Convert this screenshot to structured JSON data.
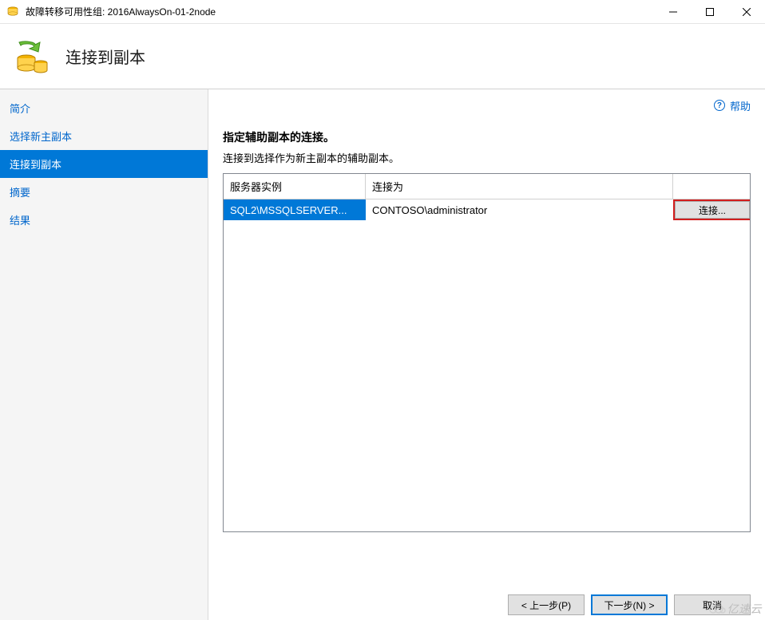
{
  "window": {
    "title": "故障转移可用性组: 2016AlwaysOn-01-2node"
  },
  "header": {
    "title": "连接到副本"
  },
  "help": {
    "label": "帮助"
  },
  "sidebar": {
    "steps": [
      {
        "label": "简介"
      },
      {
        "label": "选择新主副本"
      },
      {
        "label": "连接到副本"
      },
      {
        "label": "摘要"
      },
      {
        "label": "结果"
      }
    ],
    "active_index": 2
  },
  "content": {
    "section_title": "指定辅助副本的连接。",
    "section_sub": "连接到选择作为新主副本的辅助副本。",
    "grid": {
      "headers": {
        "server": "服务器实例",
        "connect_as": "连接为",
        "action": ""
      },
      "rows": [
        {
          "server": "SQL2\\MSSQLSERVER...",
          "connect_as": "CONTOSO\\administrator",
          "action_label": "连接..."
        }
      ]
    }
  },
  "buttons": {
    "prev": "< 上一步(P)",
    "next": "下一步(N) >",
    "cancel": "取消"
  },
  "watermark": "亿速云"
}
